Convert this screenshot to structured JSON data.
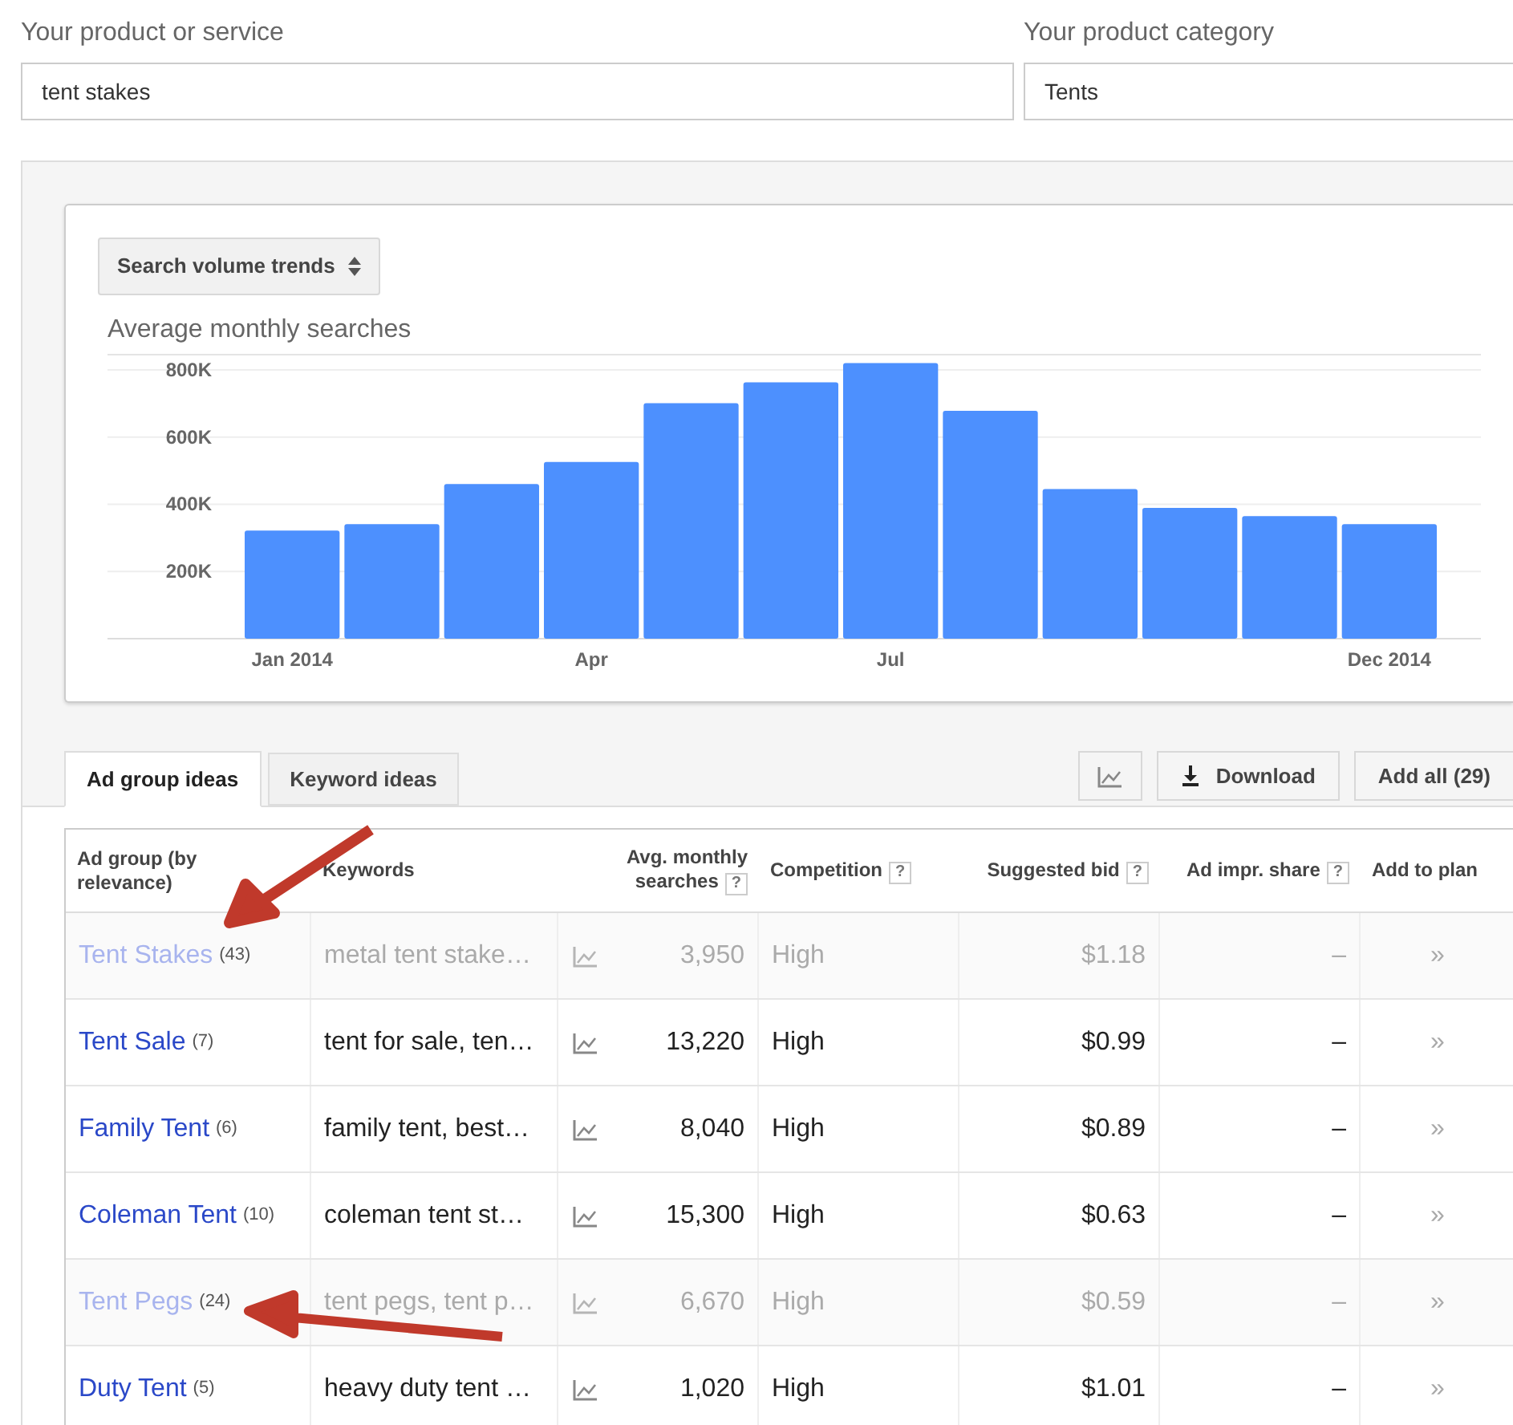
{
  "product_field": {
    "label": "Your product or service",
    "value": "tent stakes"
  },
  "category_field": {
    "label": "Your product category",
    "value": "Tents"
  },
  "trends": {
    "selector": "Search volume trends",
    "chart_data": {
      "type": "bar",
      "title": "Average monthly searches",
      "categories": [
        "Jan 2014",
        null,
        null,
        "Apr",
        null,
        null,
        "Jul",
        null,
        null,
        null,
        null,
        "Dec 2014"
      ],
      "series": [
        {
          "color": "#4d90fe",
          "values": [
            322000,
            341000,
            460000,
            526000,
            701000,
            763000,
            820000,
            678000,
            445000,
            389000,
            365000,
            341000
          ]
        }
      ],
      "ylim": [
        0,
        850000
      ],
      "grid": true,
      "yticks": [
        {
          "value": 200000,
          "label": "200K"
        },
        {
          "value": 400000,
          "label": "400K"
        },
        {
          "value": 600000,
          "label": "600K"
        },
        {
          "value": 800000,
          "label": "800K"
        }
      ]
    }
  },
  "tabs": [
    {
      "label": "Ad group ideas",
      "selected": true
    },
    {
      "label": "Keyword ideas",
      "selected": false
    }
  ],
  "toolbar": {
    "download": "Download",
    "add_all": "Add all (29)"
  },
  "table": {
    "columns": [
      {
        "label": "Ad group (by relevance)",
        "help": false
      },
      {
        "label": "Keywords",
        "help": false
      },
      {
        "label": "Avg. monthly searches",
        "help": true
      },
      {
        "label": "Competition",
        "help": true
      },
      {
        "label": "Suggested bid",
        "help": true
      },
      {
        "label": "Ad impr. share",
        "help": true
      },
      {
        "label": "Add to plan",
        "help": false
      }
    ],
    "help_mark": "?",
    "rows": [
      {
        "name": "Tent Stakes",
        "count": "(43)",
        "keywords": "metal tent stake…",
        "searches": "3,950",
        "competition": "High",
        "bid": "$1.18",
        "share": "–",
        "add": "»",
        "dimmed": true,
        "arrow": true
      },
      {
        "name": "Tent Sale",
        "count": "(7)",
        "keywords": "tent for sale, ten…",
        "searches": "13,220",
        "competition": "High",
        "bid": "$0.99",
        "share": "–",
        "add": "»",
        "dimmed": false
      },
      {
        "name": "Family Tent",
        "count": "(6)",
        "keywords": "family tent, best…",
        "searches": "8,040",
        "competition": "High",
        "bid": "$0.89",
        "share": "–",
        "add": "»",
        "dimmed": false
      },
      {
        "name": "Coleman Tent",
        "count": "(10)",
        "keywords": "coleman tent st…",
        "searches": "15,300",
        "competition": "High",
        "bid": "$0.63",
        "share": "–",
        "add": "»",
        "dimmed": false
      },
      {
        "name": "Tent Pegs",
        "count": "(24)",
        "keywords": "tent pegs, tent p…",
        "searches": "6,670",
        "competition": "High",
        "bid": "$0.59",
        "share": "–",
        "add": "»",
        "dimmed": true,
        "arrow": true
      },
      {
        "name": "Duty Tent",
        "count": "(5)",
        "keywords": "heavy duty tent …",
        "searches": "1,020",
        "competition": "High",
        "bid": "$1.01",
        "share": "–",
        "add": "»",
        "dimmed": false
      }
    ]
  }
}
